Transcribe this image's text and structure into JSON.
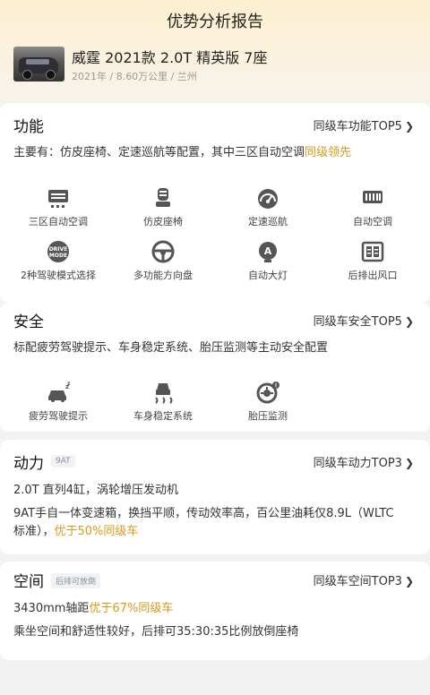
{
  "header": {
    "title": "优势分析报告",
    "car_name": "威霆 2021款 2.0T 精英版 7座",
    "car_meta": "2021年 / 8.60万公里 / 兰州"
  },
  "sections": {
    "function": {
      "title": "功能",
      "link": "同级车功能TOP5",
      "desc_prefix": "主要有：仿皮座椅、定速巡航等配置，其中三区自动空调",
      "desc_highlight": "同级领先",
      "features": [
        {
          "label": "三区自动空调",
          "icon": "ac-vent-icon"
        },
        {
          "label": "仿皮座椅",
          "icon": "seat-icon"
        },
        {
          "label": "定速巡航",
          "icon": "speedometer-icon"
        },
        {
          "label": "自动空调",
          "icon": "auto-ac-icon"
        },
        {
          "label": "2种驾驶模式选择",
          "icon": "drive-mode-icon"
        },
        {
          "label": "多功能方向盘",
          "icon": "steering-wheel-icon"
        },
        {
          "label": "自动大灯",
          "icon": "headlight-icon"
        },
        {
          "label": "后排出风口",
          "icon": "rear-vent-icon"
        }
      ]
    },
    "safety": {
      "title": "安全",
      "link": "同级车安全TOP5",
      "desc": "标配疲劳驾驶提示、车身稳定系统、胎压监测等主动安全配置",
      "features": [
        {
          "label": "疲劳驾驶提示",
          "icon": "fatigue-warning-icon"
        },
        {
          "label": "车身稳定系统",
          "icon": "stability-control-icon"
        },
        {
          "label": "胎压监测",
          "icon": "tire-pressure-icon"
        }
      ]
    },
    "power": {
      "title": "动力",
      "tag": "9AT",
      "link": "同级车动力TOP3",
      "line1": "2.0T 直列4缸，涡轮增压发动机",
      "line2": "9AT手自一体变速箱，换挡平顺，传动效率高，百公里油耗仅8.9L（WLTC",
      "line3_prefix": "标准），",
      "line3_highlight": "优于50%同级车"
    },
    "space": {
      "title": "空间",
      "tag": "后排可放倒",
      "link": "同级车空间TOP3",
      "line1_prefix": "3430mm轴距",
      "line1_highlight": "优于67%同级车",
      "line2": "乘坐空间和舒适性较好，后排可35:30:35比例放倒座椅"
    }
  },
  "colors": {
    "highlight": "#d89a18",
    "accent_bg": "#fdf0cf"
  }
}
